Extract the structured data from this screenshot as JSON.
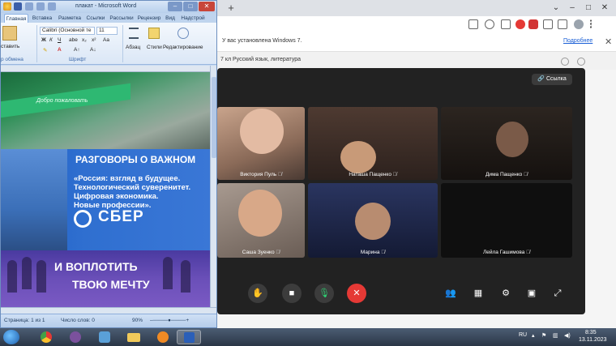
{
  "word": {
    "title": "плакат - Microsoft Word",
    "tabs": [
      "Главная",
      "Вставка",
      "Разметка",
      "Ссылки",
      "Рассылки",
      "Рецензир",
      "Вид",
      "Надстрой"
    ],
    "ribbon": {
      "paste_label": "ставить",
      "clipboard_label": "р обмена",
      "font_name": "Calibri (Основной те",
      "font_size": "11",
      "font_group_label": "Шрифт",
      "paragraph_label": "Абзац",
      "styles_label": "Стили",
      "editing_label": "Редактирование"
    },
    "poster": {
      "welcome": "Добро пожаловать",
      "heading": "РАЗГОВОРЫ О ВАЖНОМ",
      "quote_lines": [
        "«Россия: взгляд в будущее.",
        "Технологический суверенитет.",
        "Цифровая экономика.",
        "Новые профессии»."
      ],
      "sber": "СБЕР",
      "dream_line1": "И ВОПЛОТИТЬ",
      "dream_line2": "ТВОЮ МЕЧТУ"
    },
    "status": {
      "page": "Страница: 1 из 1",
      "words": "Число слов: 0",
      "zoom": "90%"
    }
  },
  "chrome": {
    "infobar_text": "У вас установлена Windows 7.",
    "infobar_link": "Подробнее",
    "page_title": "7 кл Русский язык, литература"
  },
  "call": {
    "link_button": "Ссылка",
    "participants": [
      {
        "name": "Виктория Пуль"
      },
      {
        "name": "Наташа Пащенко"
      },
      {
        "name": "Дима Пащенко"
      },
      {
        "name": "Саша Зуенко"
      },
      {
        "name": "Марина"
      },
      {
        "name": "Лейла Гашимова"
      }
    ]
  },
  "taskbar": {
    "lang": "RU",
    "time": "8:35",
    "date": "13.11.2023"
  },
  "colors": {
    "accent_red": "#e53935",
    "mic_green": "#2ecc71",
    "call_bg": "#222222",
    "sber_blue": "#2f6fd0"
  }
}
